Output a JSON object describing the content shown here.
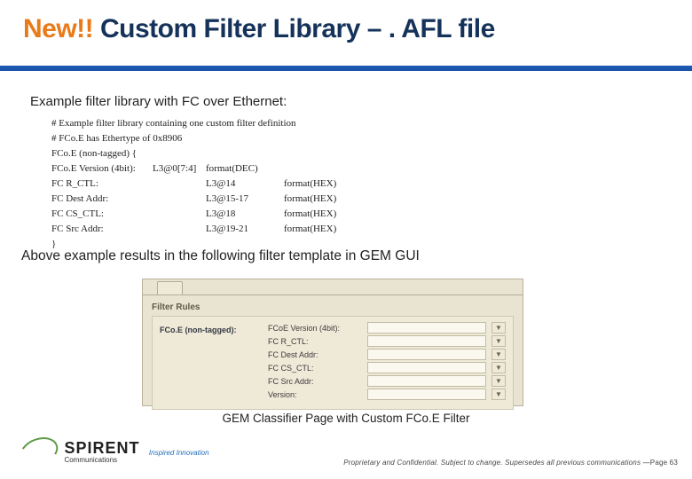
{
  "title": {
    "prefix_orange": "New!! ",
    "rest": "Custom Filter Library – . AFL file"
  },
  "subhead": "Example filter library with FC over Ethernet:",
  "code": {
    "comment1": "# Example filter library containing one custom filter definition",
    "comment2": "# FCo.E has Ethertype of 0x8906",
    "open_line": "FCo.E (non-tagged) {",
    "rows": [
      {
        "c1": "FCo.E Version (4bit):",
        "c2": "L3@0[7:4]",
        "c3": "format(DEC)",
        "c4": ""
      },
      {
        "c1": "FC R_CTL:",
        "c2": "",
        "c3": "L3@14",
        "c4": "format(HEX)"
      },
      {
        "c1": "FC Dest Addr:",
        "c2": "",
        "c3": "L3@15-17",
        "c4": "format(HEX)"
      },
      {
        "c1": "FC CS_CTL:",
        "c2": "",
        "c3": "L3@18",
        "c4": "format(HEX)"
      },
      {
        "c1": "FC Src Addr:",
        "c2": "",
        "c3": "L3@19-21",
        "c4": "format(HEX)"
      }
    ],
    "close_line": "}"
  },
  "result_line": "Above example results in the following filter template in GEM GUI",
  "gem_panel": {
    "tab_text": "",
    "filter_rules_label": "Filter Rules",
    "group_label": "FCo.E (non-tagged):",
    "rows": [
      "FCoE Version (4bit):",
      "FC R_CTL:",
      "FC Dest Addr:",
      "FC CS_CTL:",
      "FC Src Addr:",
      "Version:"
    ],
    "arrow": "▼"
  },
  "caption": "GEM Classifier Page with Custom FCo.E Filter",
  "logo": {
    "name": "SPIRENT",
    "sub": "Communications",
    "tagline": "Inspired Innovation"
  },
  "footer": {
    "text": "Proprietary and Confidential. Subject to change. Supersedes all previous communications —",
    "page": "Page 63"
  }
}
